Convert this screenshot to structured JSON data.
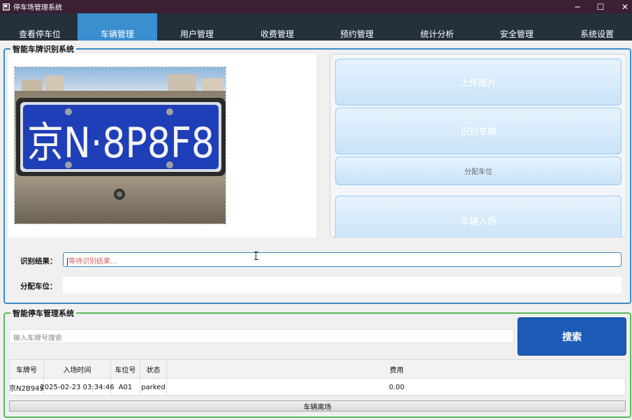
{
  "window": {
    "title": "停车场管理系统",
    "minimize_glyph": "─",
    "maximize_glyph": "☐",
    "close_glyph": "✕"
  },
  "tabs": [
    {
      "label": "查看停车位",
      "active": false
    },
    {
      "label": "车辆管理",
      "active": true
    },
    {
      "label": "用户管理",
      "active": false
    },
    {
      "label": "收费管理",
      "active": false
    },
    {
      "label": "预约管理",
      "active": false
    },
    {
      "label": "统计分析",
      "active": false
    },
    {
      "label": "安全管理",
      "active": false
    },
    {
      "label": "系统设置",
      "active": false
    }
  ],
  "recognition": {
    "group_title": "智能车牌识别系统",
    "plate_text": "京N·8P8F8",
    "buttons": {
      "upload": "上传图片",
      "recognize": "识别车牌",
      "assign": "分配车位",
      "enter": "车辆入场"
    },
    "result_label": "识别结果：",
    "result_placeholder": "等待识别结果...",
    "space_label": "分配车位：",
    "space_value": ""
  },
  "parking": {
    "group_title": "智能停车管理系统",
    "search_placeholder": "输入车牌号搜索",
    "search_button": "搜索",
    "columns": [
      "车牌号",
      "入场时间",
      "车位号",
      "状态",
      "费用"
    ],
    "rows": [
      [
        "京N2B945",
        "2025-02-23 03:34:46",
        "A01",
        "parked",
        "0.00"
      ]
    ],
    "leave_button": "车辆离场"
  },
  "colors": {
    "titlebar": "#3b1f33",
    "tabbar": "#25303d",
    "active_tab": "#3a8fcf",
    "search_button": "#1c5bb6",
    "plate_blue": "#1f3fb8"
  }
}
